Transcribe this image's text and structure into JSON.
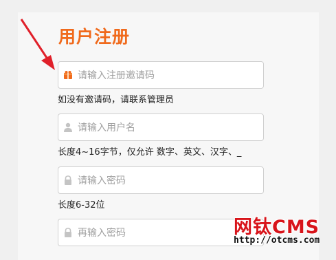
{
  "page": {
    "title": "用户注册"
  },
  "form": {
    "invite_code": {
      "placeholder": "请输入注册邀请码",
      "icon": "gift-icon",
      "hint": "如没有邀请码，请联系管理员"
    },
    "username": {
      "placeholder": "请输入用户名",
      "icon": "user-icon",
      "hint": "长度4~16字节，仅允许 数字、英文、汉字、_"
    },
    "password": {
      "placeholder": "请输入密码",
      "icon": "lock-icon",
      "hint": "长度6-32位"
    },
    "password_confirm": {
      "placeholder": "再输入密码",
      "icon": "lock-icon"
    }
  },
  "watermark": {
    "logo": "网钛CMS",
    "url": "http://otcms.com"
  },
  "colors": {
    "title": "#f06a1c",
    "arrow": "#e0202a",
    "watermark": "#d8141a",
    "icon": "#c4c4c4",
    "invite_icon": "#f06a1c"
  }
}
